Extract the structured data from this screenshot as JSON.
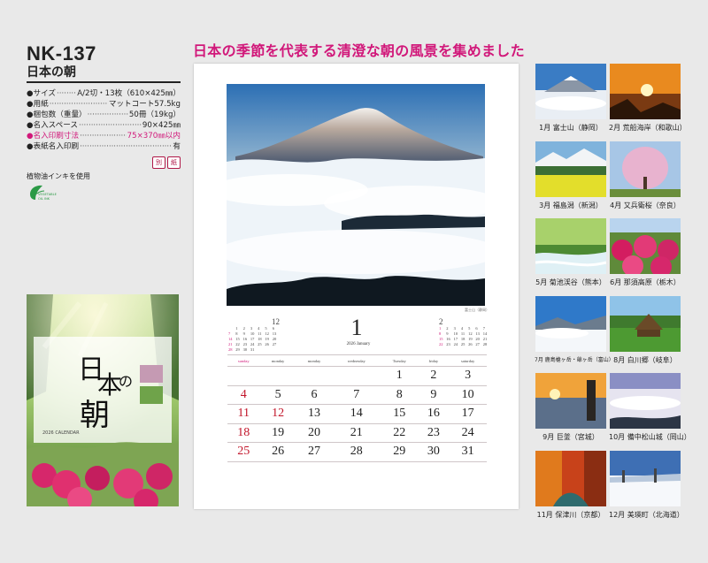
{
  "product": {
    "code": "NK-137",
    "title": "日本の朝",
    "headline": "日本の季節を代表する清澄な朝の風景を集めました"
  },
  "specs": [
    {
      "label": "●サイズ",
      "value": "A/2切・13枚（610×425㎜）",
      "highlight": false
    },
    {
      "label": "●用紙",
      "value": "マットコート57.5kg",
      "highlight": false
    },
    {
      "label": "●梱包数（重量）",
      "value": "50冊（19kg）",
      "highlight": false
    },
    {
      "label": "●名入スペース",
      "value": "90×425㎜",
      "highlight": false
    },
    {
      "label": "●名入印刷寸法",
      "value": "75×370㎜以内",
      "highlight": true
    },
    {
      "label": "●表紙名入印刷",
      "value": "有",
      "highlight": false
    }
  ],
  "badges": [
    "別",
    "紙"
  ],
  "ink_note": "植物油インキを使用",
  "veg_logo": "VEGETABLE OIL INK",
  "cover": {
    "title_line": "日本の朝",
    "sub": "2026 CALENDAR"
  },
  "calendar": {
    "month": "1",
    "sub": "2026 January",
    "credit": "富士山（静岡）",
    "weekdays": [
      "sunday",
      "monday",
      "monday",
      "wednesday",
      "Tuesday",
      "friday",
      "saturday"
    ],
    "weeks": [
      [
        "",
        "",
        "",
        "",
        "1",
        "2",
        "3"
      ],
      [
        "4",
        "5",
        "6",
        "7",
        "8",
        "9",
        "10"
      ],
      [
        "11",
        "12",
        "13",
        "14",
        "15",
        "16",
        "17"
      ],
      [
        "18",
        "19",
        "20",
        "21",
        "22",
        "23",
        "24"
      ],
      [
        "25",
        "26",
        "27",
        "28",
        "29",
        "30",
        "31"
      ]
    ],
    "red_days": [
      "12"
    ],
    "prev": {
      "month": "12",
      "days": [
        "",
        "1",
        "2",
        "3",
        "4",
        "5",
        "6",
        "7",
        "8",
        "9",
        "10",
        "11",
        "12",
        "13",
        "14",
        "15",
        "16",
        "17",
        "18",
        "19",
        "20",
        "21",
        "22",
        "23",
        "24",
        "25",
        "26",
        "27",
        "28",
        "29",
        "30",
        "31",
        "",
        "",
        ""
      ]
    },
    "next": {
      "month": "2",
      "days": [
        "1",
        "2",
        "3",
        "4",
        "5",
        "6",
        "7",
        "8",
        "9",
        "10",
        "11",
        "12",
        "13",
        "14",
        "15",
        "16",
        "17",
        "18",
        "19",
        "20",
        "21",
        "22",
        "23",
        "24",
        "25",
        "26",
        "27",
        "28"
      ]
    }
  },
  "thumbnails": [
    {
      "caption": "1月 富士山（静岡）",
      "theme": "fuji"
    },
    {
      "caption": "2月 荒船海岸（和歌山）",
      "theme": "sunrise"
    },
    {
      "caption": "3月 福島潟（新潟）",
      "theme": "field"
    },
    {
      "caption": "4月 又兵衛桜（奈良）",
      "theme": "sakura"
    },
    {
      "caption": "5月 菊池渓谷（熊本）",
      "theme": "forest"
    },
    {
      "caption": "6月 那須高原（栃木）",
      "theme": "azalea"
    },
    {
      "caption": "7月 鹿島槍ヶ岳・爺ヶ岳（富山）",
      "theme": "clouds"
    },
    {
      "caption": "8月 白川郷（岐阜）",
      "theme": "village"
    },
    {
      "caption": "9月 巨釜（宮城）",
      "theme": "rock"
    },
    {
      "caption": "10月 備中松山城（岡山）",
      "theme": "castle"
    },
    {
      "caption": "11月 保津川（京都）",
      "theme": "autumn"
    },
    {
      "caption": "12月 美瑛町（北海道）",
      "theme": "snow"
    }
  ],
  "colors": {
    "accent": "#d1187a",
    "holiday": "#c2152a"
  }
}
